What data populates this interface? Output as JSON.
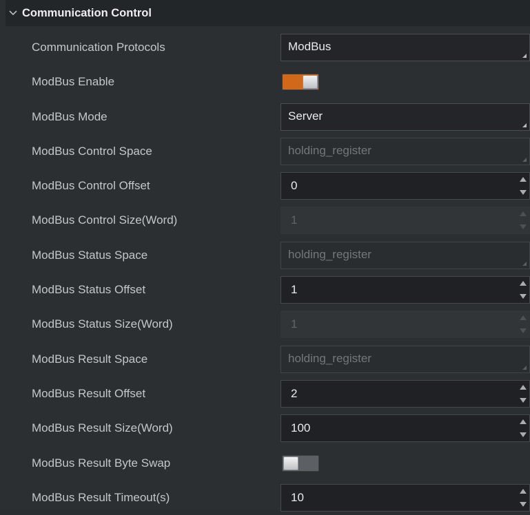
{
  "section": {
    "title": "Communication Control",
    "icon": "chevron-down-icon"
  },
  "rows": [
    {
      "label": "Communication Protocols",
      "type": "combo",
      "value": "ModBus",
      "enabled": true
    },
    {
      "label": "ModBus Enable",
      "type": "toggle",
      "value": "on"
    },
    {
      "label": "ModBus Mode",
      "type": "combo",
      "value": "Server",
      "enabled": true
    },
    {
      "label": "ModBus Control Space",
      "type": "combo",
      "value": "holding_register",
      "enabled": false
    },
    {
      "label": "ModBus Control Offset",
      "type": "spin",
      "value": "0",
      "enabled": true
    },
    {
      "label": "ModBus Control Size(Word)",
      "type": "spin",
      "value": "1",
      "enabled": false
    },
    {
      "label": "ModBus Status Space",
      "type": "combo",
      "value": "holding_register",
      "enabled": false
    },
    {
      "label": "ModBus Status Offset",
      "type": "spin",
      "value": "1",
      "enabled": true
    },
    {
      "label": "ModBus Status Size(Word)",
      "type": "spin",
      "value": "1",
      "enabled": false
    },
    {
      "label": "ModBus Result Space",
      "type": "combo",
      "value": "holding_register",
      "enabled": false
    },
    {
      "label": "ModBus Result Offset",
      "type": "spin",
      "value": "2",
      "enabled": true
    },
    {
      "label": "ModBus Result Size(Word)",
      "type": "spin",
      "value": "100",
      "enabled": true
    },
    {
      "label": "ModBus Result Byte Swap",
      "type": "toggle",
      "value": "off"
    },
    {
      "label": "ModBus Result Timeout(s)",
      "type": "spin",
      "value": "10",
      "enabled": true
    }
  ],
  "colors": {
    "accent": "#d2691a",
    "background": "#2c2f32",
    "header": "#232629"
  }
}
